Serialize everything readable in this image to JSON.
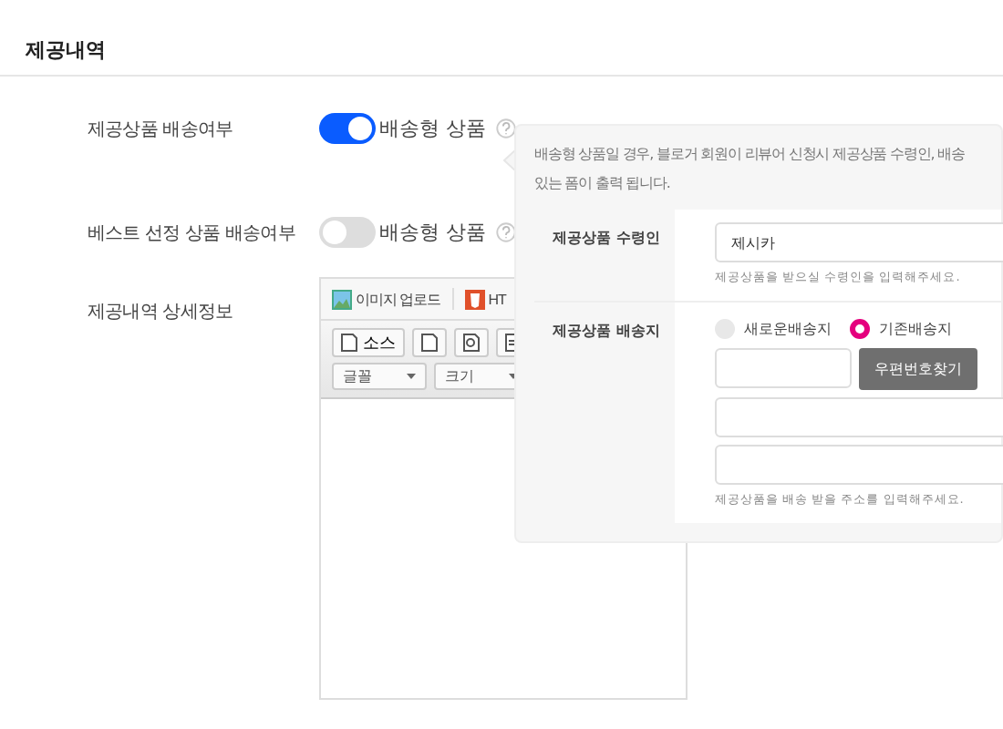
{
  "section_title": "제공내역",
  "rows": [
    {
      "label": "제공상품 배송여부",
      "toggle": {
        "on": true,
        "label": "배송형 상품"
      }
    },
    {
      "label": "베스트 선정 상품 배송여부",
      "toggle": {
        "on": false,
        "label": "배송형 상품"
      }
    }
  ],
  "detail": {
    "label": "제공내역 상세정보",
    "editor": {
      "tabs": [
        "이미지 업로드",
        "HT"
      ],
      "source_button": "소스",
      "fonts": [
        {
          "label": "글꼴"
        },
        {
          "label": "크기"
        }
      ]
    }
  },
  "popover": {
    "description": "배송형 상품일 경우, 블로거 회원이 리뷰어 신청시 제공상품 수령인, 배송",
    "description_line2": "있는 폼이 출력 됩니다.",
    "recipient": {
      "label": "제공상품 수령인",
      "value": "제시카",
      "hint": "제공상품을 받으실 수령인을 입력해주세요."
    },
    "address": {
      "label": "제공상품 배송지",
      "options": [
        {
          "label": "새로운배송지",
          "selected": false
        },
        {
          "label": "기존배송지",
          "selected": true
        }
      ],
      "zip_button": "우편번호찾기",
      "hint": "제공상품을 배송 받을 주소를 입력해주세요."
    }
  }
}
